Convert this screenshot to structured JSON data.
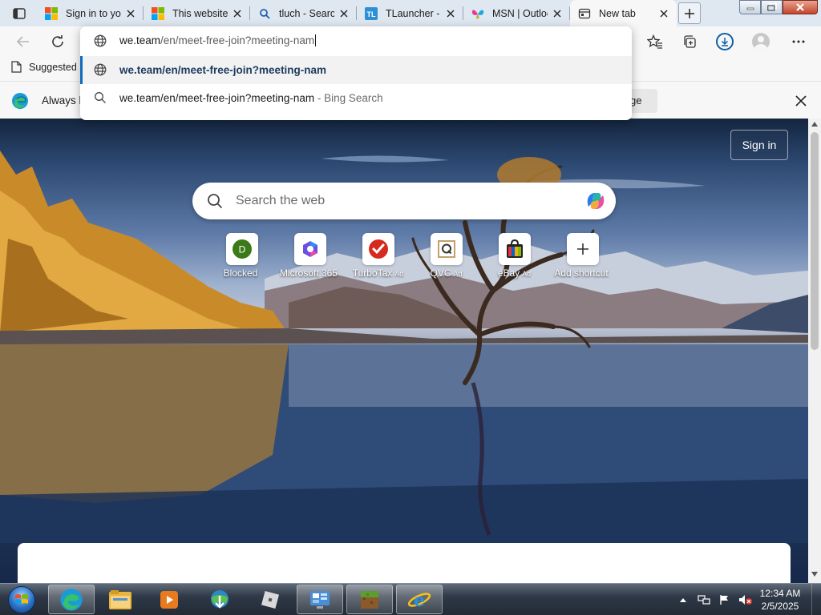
{
  "tabs": [
    {
      "title": "Sign in to your account",
      "favicon": "microsoft-icon"
    },
    {
      "title": "This website",
      "favicon": "microsoft-icon"
    },
    {
      "title": "tluch - Search",
      "favicon": "search-icon"
    },
    {
      "title": "TLauncher - ",
      "favicon": "tlauncher-icon"
    },
    {
      "title": "MSN | Outlook",
      "favicon": "msn-butterfly-icon"
    },
    {
      "title": "New tab",
      "favicon": "newtab-icon",
      "active": true
    }
  ],
  "omnibox": {
    "host": "we.team",
    "path": "/en/meet-free-join?meeting-nam",
    "suggestion_1": "we.team/en/meet-free-join?meeting-nam",
    "suggestion_2": "we.team/en/meet-free-join?meeting-nam",
    "suggestion_2_suffix": "- Bing Search"
  },
  "favorites_bar": {
    "suggested_label": "Suggested"
  },
  "infobar": {
    "text": "Always b",
    "button_label": "ge"
  },
  "newtab": {
    "sign_in_label": "Sign in",
    "search_placeholder": "Search the web",
    "shortcuts": [
      {
        "label": "Blocked",
        "ad": "",
        "icon": "blocked-d-icon"
      },
      {
        "label": "Microsoft 365",
        "ad": "",
        "icon": "microsoft365-icon"
      },
      {
        "label": "TurboTax",
        "ad": "Ad",
        "icon": "turbotax-icon"
      },
      {
        "label": "QVC",
        "ad": "Ad",
        "icon": "qvc-icon"
      },
      {
        "label": "eBay",
        "ad": "Ad",
        "icon": "ebay-icon"
      },
      {
        "label": "Add shortcut",
        "ad": "",
        "icon": "plus-icon"
      }
    ]
  },
  "taskbar": {
    "apps": [
      "edge-icon",
      "file-explorer-icon",
      "media-player-icon",
      "internet-download-manager-icon",
      "roblox-icon",
      "control-panel-icon",
      "minecraft-icon",
      "internet-explorer-icon"
    ],
    "time": "12:34 AM",
    "date": "2/5/2025"
  },
  "colors": {
    "accent": "#0f6cbd",
    "taskbar": "#2f3947"
  }
}
